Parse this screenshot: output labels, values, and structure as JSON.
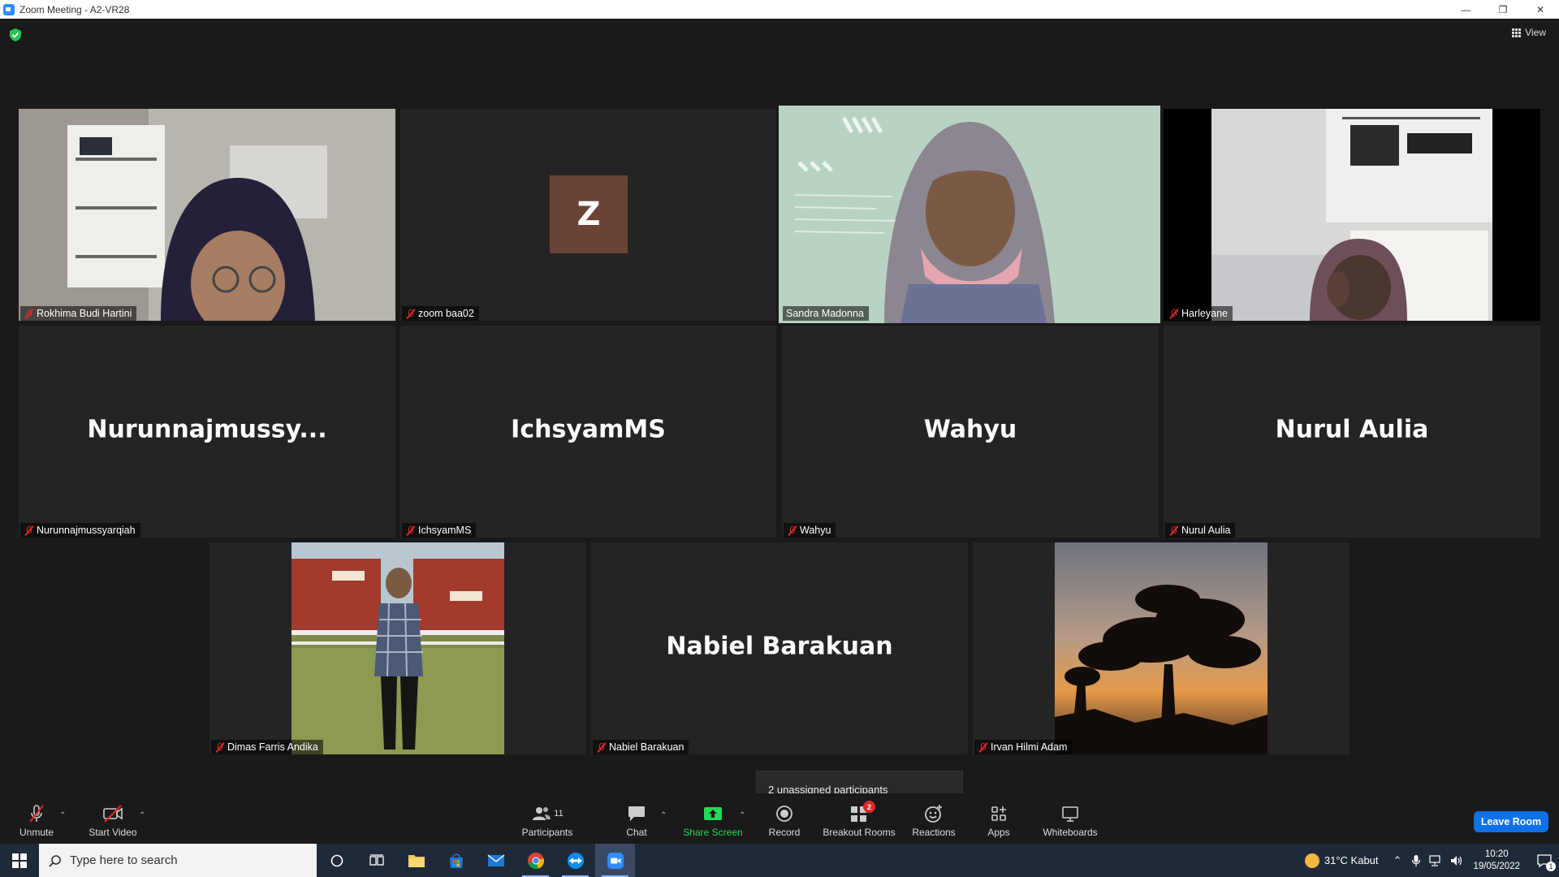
{
  "window": {
    "title": "Zoom Meeting - A2-VR28",
    "minimize": "—",
    "restore": "❐",
    "close": "✕"
  },
  "meeting": {
    "view_label": "View",
    "security_icon": "shield-check-icon",
    "accent_border": "#d7e24e"
  },
  "participants": [
    {
      "name": "Rokhima Budi Hartini",
      "type": "video",
      "muted": true
    },
    {
      "name": "zoom baa02",
      "type": "avatar",
      "avatar_letter": "Z",
      "muted": true
    },
    {
      "name": "Sandra Madonna",
      "type": "video",
      "muted": false,
      "active_speaker": true
    },
    {
      "name": "Harleyane",
      "type": "video",
      "muted": true
    },
    {
      "name": "Nurunnajmussyarqiah",
      "display": "Nurunnajmussy...",
      "type": "name",
      "muted": true
    },
    {
      "name": "IchsyamMS",
      "display": "IchsyamMS",
      "type": "name",
      "muted": true
    },
    {
      "name": "Wahyu",
      "display": "Wahyu",
      "type": "name",
      "muted": true
    },
    {
      "name": "Nurul Aulia",
      "display": "Nurul Aulia",
      "type": "name",
      "muted": true
    },
    {
      "name": "Dimas Farris Andika",
      "type": "video",
      "muted": true
    },
    {
      "name": "Nabiel Barakuan",
      "display": "Nabiel Barakuan",
      "type": "name",
      "muted": true
    },
    {
      "name": "Irvan Hilmi Adam",
      "type": "video",
      "muted": true
    }
  ],
  "tooltip": "2 unassigned participants",
  "toolbar": {
    "unmute": "Unmute",
    "start_video": "Start Video",
    "participants": "Participants",
    "participants_count": "11",
    "chat": "Chat",
    "share_screen": "Share Screen",
    "record": "Record",
    "breakout_rooms": "Breakout Rooms",
    "breakout_badge": "2",
    "reactions": "Reactions",
    "apps": "Apps",
    "whiteboards": "Whiteboards",
    "leave": "Leave Room"
  },
  "taskbar": {
    "search_placeholder": "Type here to search",
    "weather": "31°C  Kabut",
    "time": "10:20",
    "date": "19/05/2022",
    "notification_count": "1"
  }
}
